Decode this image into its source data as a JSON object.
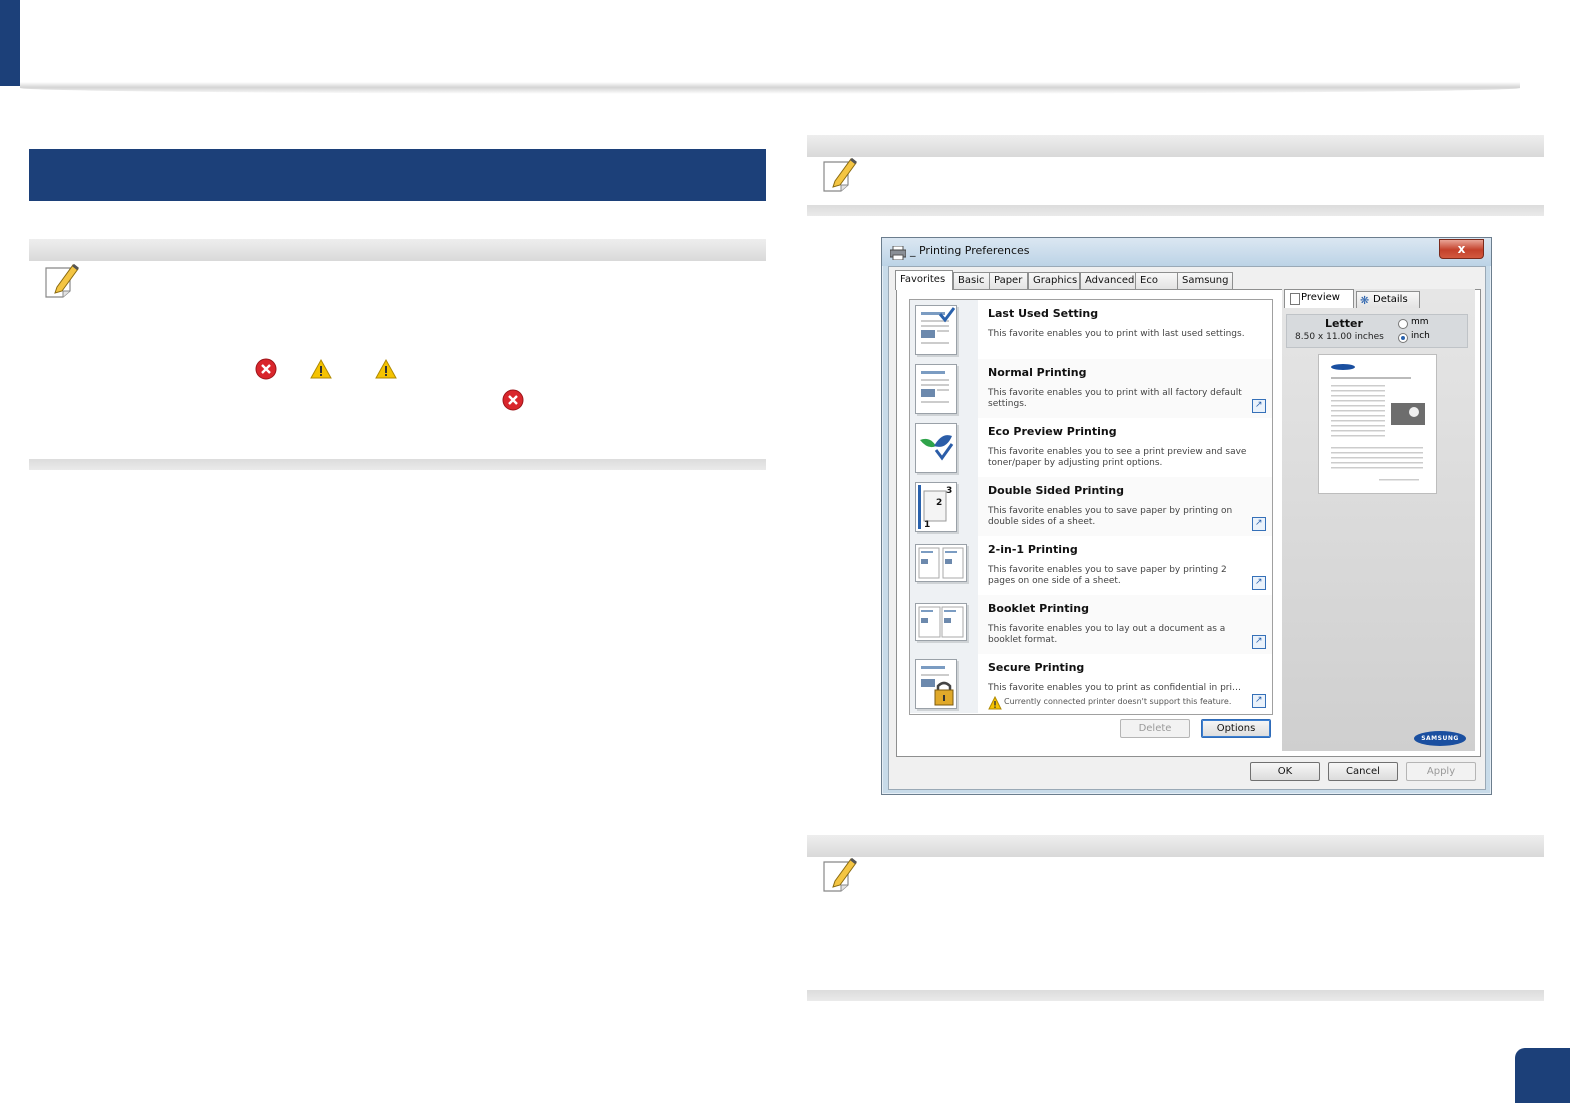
{
  "page": {
    "page_number": ""
  },
  "dialog": {
    "title": "_ Printing Preferences",
    "close_label": "x",
    "tabs": [
      "Favorites",
      "Basic",
      "Paper",
      "Graphics",
      "Advanced",
      "Eco",
      "Samsung"
    ],
    "favorites": [
      {
        "name": "Last Used Setting",
        "desc": "This favorite enables you to print with last used settings."
      },
      {
        "name": "Normal Printing",
        "desc": "This favorite enables you to print with all factory default settings."
      },
      {
        "name": "Eco Preview Printing",
        "desc": "This favorite enables you to see a print preview and save toner/paper by adjusting print options."
      },
      {
        "name": "Double Sided Printing",
        "desc": "This favorite enables you to save paper by printing on double sides of a sheet."
      },
      {
        "name": "2-in-1 Printing",
        "desc": "This favorite enables you to save paper by printing 2 pages on one side of a sheet."
      },
      {
        "name": "Booklet Printing",
        "desc": "This favorite enables you to lay out a document as a booklet format."
      },
      {
        "name": "Secure Printing",
        "desc": "This favorite enables you to print as confidential in pri…",
        "warning": "Currently connected printer doesn't support this feature."
      }
    ],
    "buttons": {
      "delete": "Delete",
      "options": "Options",
      "ok": "OK",
      "cancel": "Cancel",
      "apply": "Apply"
    },
    "preview": {
      "tab_preview": "Preview",
      "tab_details": "Details",
      "paper_name": "Letter",
      "paper_size": "8.50 x 11.00 inches",
      "unit_mm": "mm",
      "unit_inch": "inch",
      "selected_unit": "inch",
      "logo_text": "SAMSUNG"
    }
  },
  "colors": {
    "brand_blue": "#1c4079",
    "note_icon_yellow": "#f4c542",
    "error_red": "#d9262c",
    "warning_yellow": "#f5c300"
  },
  "icons": {
    "note": "pencil-note-icon",
    "error": "error-x-icon",
    "warning": "warning-triangle-icon"
  }
}
